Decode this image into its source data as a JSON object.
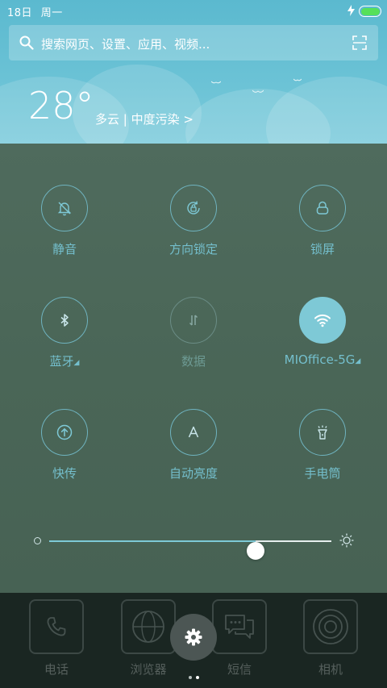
{
  "status_bar": {
    "date": "18日",
    "weekday": "周一"
  },
  "search": {
    "placeholder": "搜索网页、设置、应用、视频..."
  },
  "weather": {
    "temperature": "28°",
    "description": "多云 | 中度污染 >"
  },
  "toggles": [
    {
      "label": "静音",
      "icon": "bell-off-icon",
      "state": "off"
    },
    {
      "label": "方向锁定",
      "icon": "rotation-lock-icon",
      "state": "off"
    },
    {
      "label": "锁屏",
      "icon": "lock-icon",
      "state": "off"
    },
    {
      "label": "蓝牙",
      "icon": "bluetooth-icon",
      "state": "off"
    },
    {
      "label": "数据",
      "icon": "mobile-data-icon",
      "state": "disabled"
    },
    {
      "label": "MIOffice-5G",
      "icon": "wifi-icon",
      "state": "on"
    },
    {
      "label": "快传",
      "icon": "transfer-icon",
      "state": "off"
    },
    {
      "label": "自动亮度",
      "icon": "auto-brightness-icon",
      "state": "off"
    },
    {
      "label": "手电筒",
      "icon": "flashlight-icon",
      "state": "off"
    }
  ],
  "brightness": {
    "level": 0.73
  },
  "dock": {
    "apps": [
      {
        "label": "电话",
        "icon": "phone-icon"
      },
      {
        "label": "浏览器",
        "icon": "browser-icon"
      },
      {
        "label": "短信",
        "icon": "messages-icon"
      },
      {
        "label": "相机",
        "icon": "camera-icon"
      }
    ],
    "page_count": 2,
    "current_page": 1
  },
  "colors": {
    "accent": "#7ec9d6",
    "panel_bg": "#4a6657",
    "header_bg": "#5bb9cf",
    "battery": "#56e05a"
  }
}
